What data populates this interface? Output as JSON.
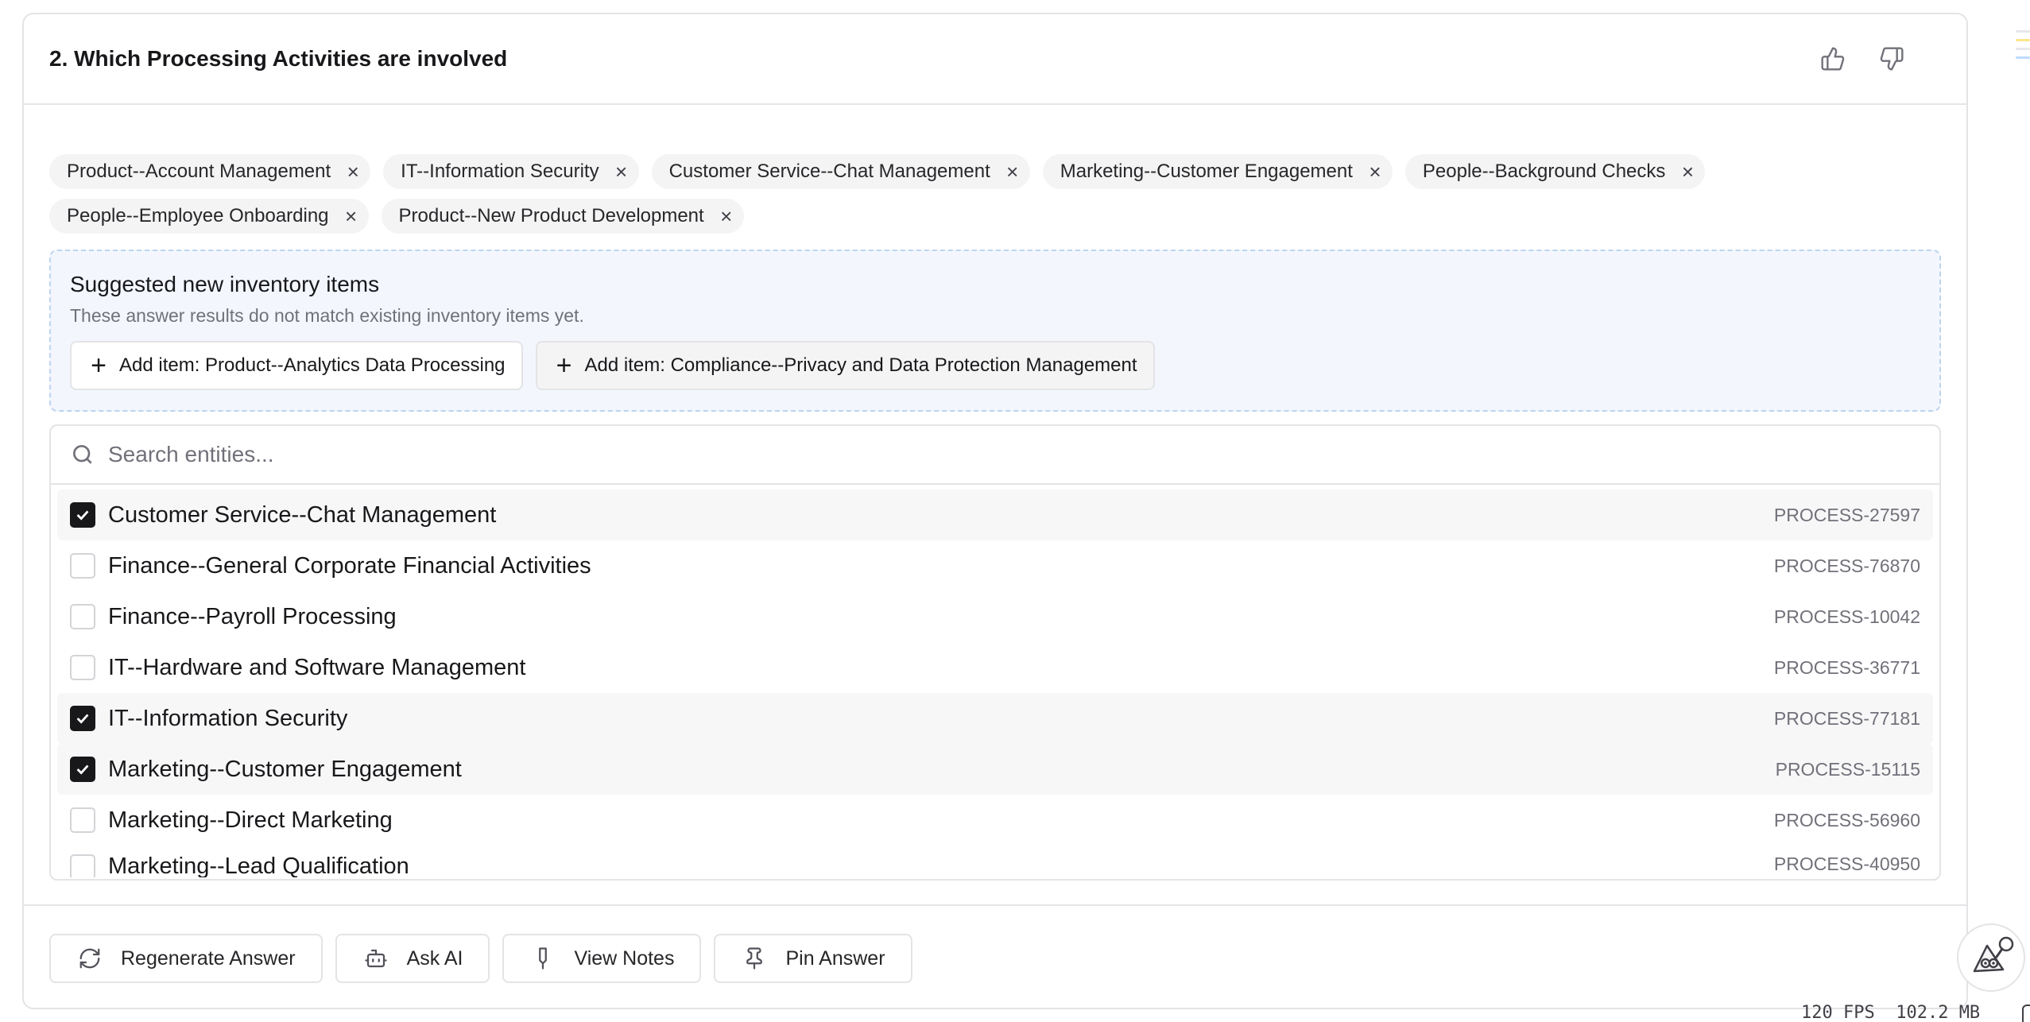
{
  "question": {
    "title": "2. Which Processing Activities are involved"
  },
  "selected_tags": [
    {
      "label": "Product--Account Management"
    },
    {
      "label": "IT--Information Security"
    },
    {
      "label": "Customer Service--Chat Management"
    },
    {
      "label": "Marketing--Customer Engagement"
    },
    {
      "label": "People--Background Checks"
    },
    {
      "label": "People--Employee Onboarding"
    },
    {
      "label": "Product--New Product Development"
    }
  ],
  "tag_remove_glyph": "×",
  "suggestions": {
    "title": "Suggested new inventory items",
    "subtitle": "These answer results do not match existing inventory items yet.",
    "items": [
      {
        "label": "Add item:  Product--Analytics Data Processing"
      },
      {
        "label": "Add item:  Compliance--Privacy and Data Protection Management"
      }
    ]
  },
  "search": {
    "placeholder": "Search entities...",
    "value": ""
  },
  "entities": [
    {
      "label": "Customer Service--Chat Management",
      "id": "PROCESS-27597",
      "checked": true
    },
    {
      "label": "Finance--General Corporate Financial Activities",
      "id": "PROCESS-76870",
      "checked": false
    },
    {
      "label": "Finance--Payroll Processing",
      "id": "PROCESS-10042",
      "checked": false
    },
    {
      "label": "IT--Hardware and Software Management",
      "id": "PROCESS-36771",
      "checked": false
    },
    {
      "label": "IT--Information Security",
      "id": "PROCESS-77181",
      "checked": true
    },
    {
      "label": "Marketing--Customer Engagement",
      "id": "PROCESS-15115",
      "checked": true
    },
    {
      "label": "Marketing--Direct Marketing",
      "id": "PROCESS-56960",
      "checked": false
    },
    {
      "label": "Marketing--Lead Qualification",
      "id": "PROCESS-40950",
      "checked": false
    }
  ],
  "footer": {
    "regenerate": "Regenerate Answer",
    "ask_ai": "Ask AI",
    "view_notes": "View Notes",
    "pin_answer": "Pin Answer"
  },
  "stats": {
    "fps": "120 FPS",
    "memory": "102.2 MB"
  },
  "icons": {
    "thumbs_up": "thumbs-up-icon",
    "thumbs_down": "thumbs-down-icon",
    "search": "search-icon",
    "plus": "plus-icon",
    "check": "check-icon",
    "regenerate": "refresh-icon",
    "ask_ai": "bot-icon",
    "notes": "marker-icon",
    "pin": "pin-icon",
    "assistant": "mascot-icon"
  },
  "colors": {
    "accent_dark": "#18181b",
    "muted_text": "#71717a",
    "suggest_bg": "#f3f7fd",
    "suggest_border": "#bfd3f0",
    "tag_bg": "#f4f4f5"
  }
}
